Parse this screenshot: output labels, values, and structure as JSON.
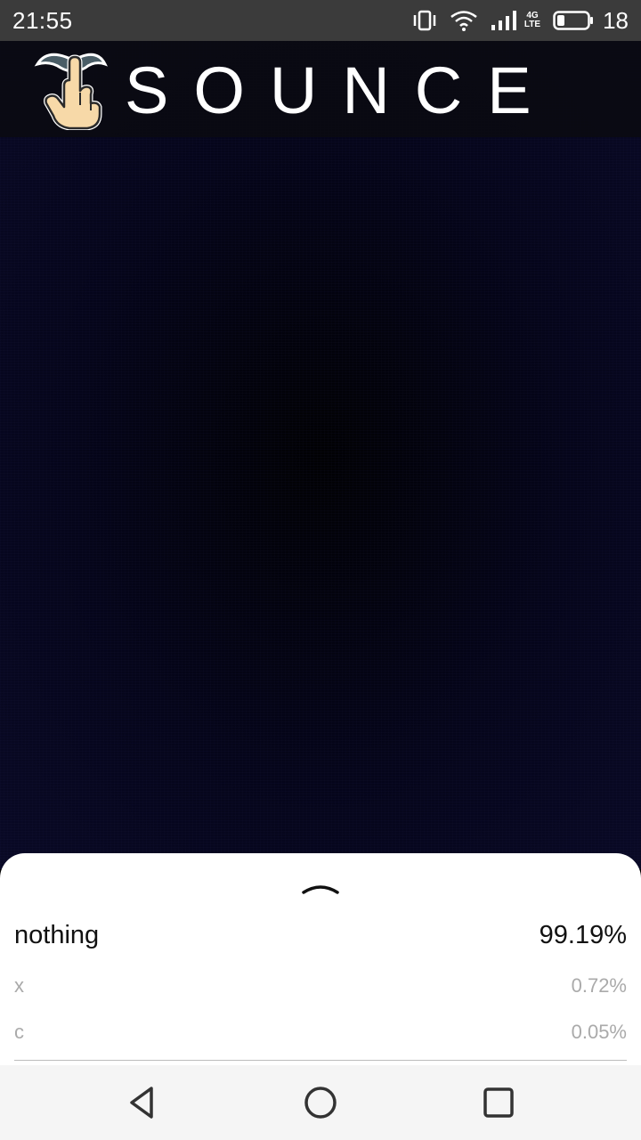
{
  "status_bar": {
    "time": "21:55",
    "network_type_top": "4G",
    "network_type_bottom": "LTE",
    "battery_level": "18",
    "icons": [
      "vibrate-icon",
      "wifi-icon",
      "signal-icon",
      "battery-icon"
    ]
  },
  "header": {
    "app_title": "SOUNCE",
    "logo_icon": "hand-pointer-logo-icon"
  },
  "bottom_sheet": {
    "handle_icon": "chevron-up-icon",
    "results": [
      {
        "label": "nothing",
        "value": "99.19%"
      },
      {
        "label": "x",
        "value": "0.72%"
      },
      {
        "label": "c",
        "value": "0.05%"
      }
    ]
  },
  "nav_bar": {
    "icons": [
      "back-icon",
      "home-icon",
      "recents-icon"
    ]
  },
  "colors": {
    "status_bar_bg": "#3b3b3b",
    "camera_bg": "#05051a",
    "sheet_bg": "#ffffff",
    "primary_text": "#111111",
    "secondary_text": "#aaaaaa",
    "nav_bar_bg": "#f5f5f5",
    "logo_skin": "#f7d9a8",
    "logo_wing": "#4a5d66"
  }
}
